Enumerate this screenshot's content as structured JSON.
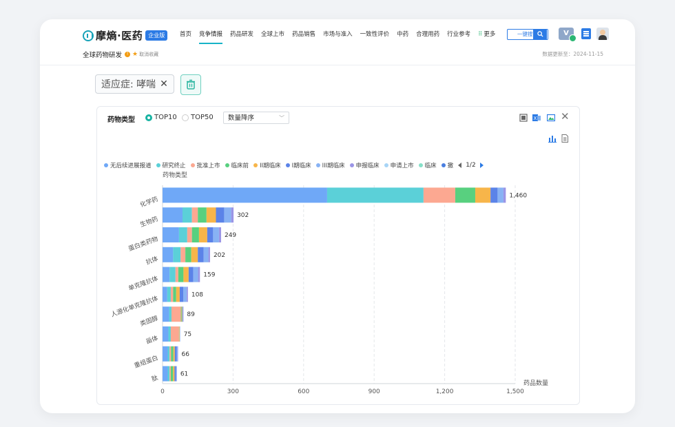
{
  "brand": {
    "name": "摩熵·医药",
    "badge": "企业版"
  },
  "nav": [
    "首页",
    "竞争情报",
    "药品研发",
    "全球上市",
    "药品销售",
    "市场与准入",
    "一致性评价",
    "中药",
    "合理用药",
    "行业参考",
    "更多"
  ],
  "nav_active": "竞争情报",
  "search": {
    "label": "一键搜索"
  },
  "vip_label": "V",
  "breadcrumb": {
    "title": "全球药物研发",
    "info": "!",
    "cancel": "取消收藏"
  },
  "update_text": "数据更新至：2024-11-15",
  "filter_tag": {
    "label": "适应症: 哮喘",
    "remove": "✕"
  },
  "panel": {
    "title": "药物类型",
    "radios": [
      {
        "label": "TOP10",
        "checked": true
      },
      {
        "label": "TOP50",
        "checked": false
      }
    ],
    "sort": "数量降序",
    "close": "✕"
  },
  "legend": {
    "items": [
      {
        "label": "无后续进展报道",
        "color": "#6fa8f7"
      },
      {
        "label": "研究终止",
        "color": "#5bd0d8"
      },
      {
        "label": "批准上市",
        "color": "#fca891"
      },
      {
        "label": "临床前",
        "color": "#58d07f"
      },
      {
        "label": "II期临床",
        "color": "#f7b54a"
      },
      {
        "label": "I期临床",
        "color": "#5b83e8"
      },
      {
        "label": "III期临床",
        "color": "#88b2f4"
      },
      {
        "label": "申报临床",
        "color": "#9b95e6"
      },
      {
        "label": "申请上市",
        "color": "#a7d5f6"
      },
      {
        "label": "临床",
        "color": "#86e0c8"
      },
      {
        "label": "撤",
        "color": "#4a7fe0"
      }
    ],
    "page": "1/2"
  },
  "chart_data": {
    "type": "bar",
    "orientation": "horizontal",
    "stacked": true,
    "ylabel": "药物类型",
    "xlabel": "药品数量",
    "xlim": [
      0,
      1500
    ],
    "xticks": [
      0,
      300,
      600,
      900,
      1200,
      1500
    ],
    "xtick_labels": [
      "0",
      "300",
      "600",
      "900",
      "1,200",
      "1,500"
    ],
    "categories": [
      "化学药",
      "生物药",
      "蛋白类药物",
      "抗体",
      "单克隆抗体",
      "人源化单克隆抗体",
      "类固醇",
      "甾体",
      "重组蛋白",
      "肽"
    ],
    "totals": [
      1460,
      302,
      249,
      202,
      159,
      108,
      89,
      75,
      66,
      61
    ],
    "total_labels": [
      "1,460",
      "302",
      "249",
      "202",
      "159",
      "108",
      "89",
      "75",
      "66",
      "61"
    ],
    "series": [
      {
        "name": "无后续进展报道",
        "color": "#6fa8f7",
        "values": [
          700,
          85,
          70,
          45,
          30,
          20,
          28,
          25,
          22,
          22
        ]
      },
      {
        "name": "研究终止",
        "color": "#5bd0d8",
        "values": [
          410,
          40,
          35,
          32,
          25,
          15,
          10,
          10,
          8,
          8
        ]
      },
      {
        "name": "批准上市",
        "color": "#fca891",
        "values": [
          135,
          25,
          20,
          20,
          12,
          10,
          40,
          35,
          6,
          5
        ]
      },
      {
        "name": "临床前",
        "color": "#58d07f",
        "values": [
          85,
          37,
          30,
          25,
          22,
          13,
          3,
          1,
          10,
          10
        ]
      },
      {
        "name": "II期临床",
        "color": "#f7b54a",
        "values": [
          65,
          40,
          35,
          28,
          22,
          15,
          3,
          2,
          6,
          6
        ]
      },
      {
        "name": "I期临床",
        "color": "#5b83e8",
        "values": [
          30,
          35,
          25,
          25,
          20,
          15,
          2,
          1,
          8,
          6
        ]
      },
      {
        "name": "III期临床",
        "color": "#88b2f4",
        "values": [
          25,
          30,
          25,
          20,
          20,
          15,
          2,
          1,
          4,
          3
        ]
      },
      {
        "name": "申报临床",
        "color": "#9b95e6",
        "values": [
          10,
          10,
          9,
          7,
          8,
          5,
          1,
          0,
          2,
          1
        ]
      }
    ]
  }
}
